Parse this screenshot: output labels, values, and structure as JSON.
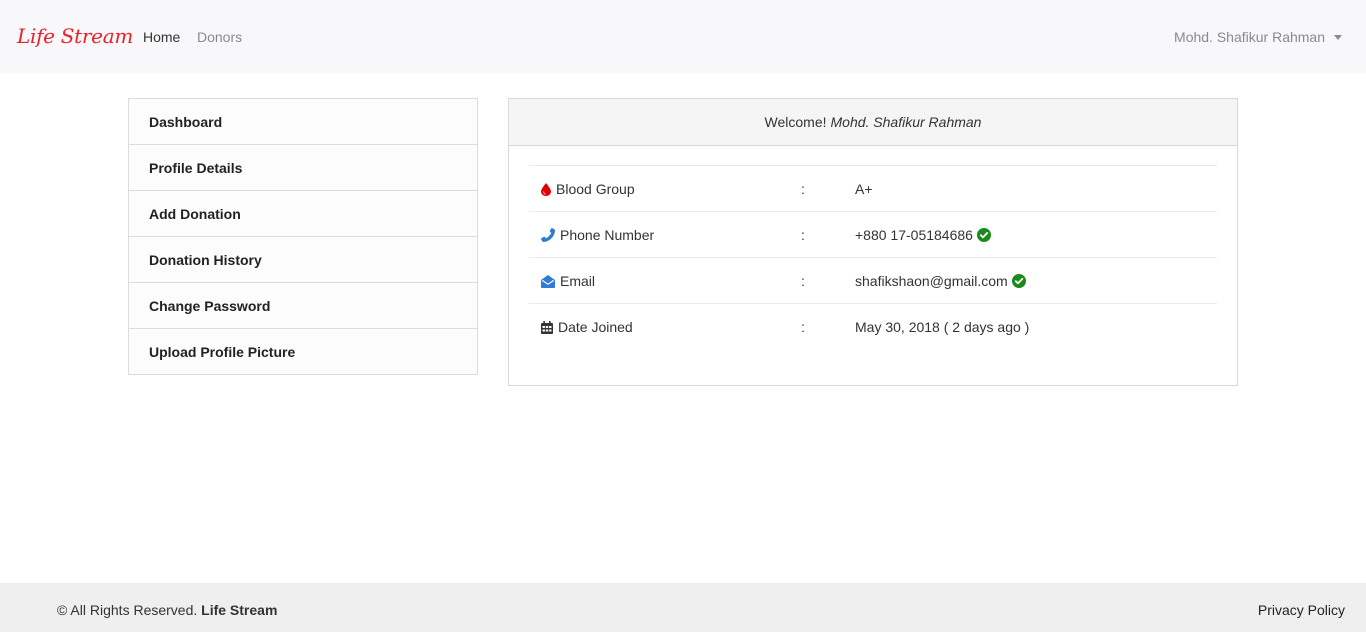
{
  "navbar": {
    "brand": "Life Stream",
    "links": [
      {
        "label": "Home"
      },
      {
        "label": "Donors"
      }
    ],
    "user_name": "Mohd. Shafikur Rahman"
  },
  "sidebar": {
    "items": [
      {
        "label": "Dashboard"
      },
      {
        "label": "Profile Details"
      },
      {
        "label": "Add Donation"
      },
      {
        "label": "Donation History"
      },
      {
        "label": "Change Password"
      },
      {
        "label": "Upload Profile Picture"
      }
    ]
  },
  "card": {
    "welcome_prefix": "Welcome!",
    "welcome_name": "Mohd. Shafikur Rahman",
    "rows": [
      {
        "icon": "blood-drop-icon",
        "label": "Blood Group",
        "sep": ":",
        "value": "A+",
        "verified": false
      },
      {
        "icon": "phone-icon",
        "label": "Phone Number",
        "sep": ":",
        "value": "+880 17-05184686",
        "verified": true
      },
      {
        "icon": "envelope-open-icon",
        "label": "Email",
        "sep": ":",
        "value": "shafikshaon@gmail.com",
        "verified": true
      },
      {
        "icon": "calendar-icon",
        "label": "Date Joined",
        "sep": ":",
        "value": "May 30, 2018 ( 2 days ago )",
        "verified": false
      }
    ]
  },
  "footer": {
    "copyright_text": "© All Rights Reserved.",
    "copyright_brand": "Life Stream",
    "privacy_label": "Privacy Policy"
  },
  "colors": {
    "brand": "#e8212a",
    "blood_icon": "#e00000",
    "contact_icon": "#2f7bd6",
    "verified": "#1a8a1a"
  }
}
